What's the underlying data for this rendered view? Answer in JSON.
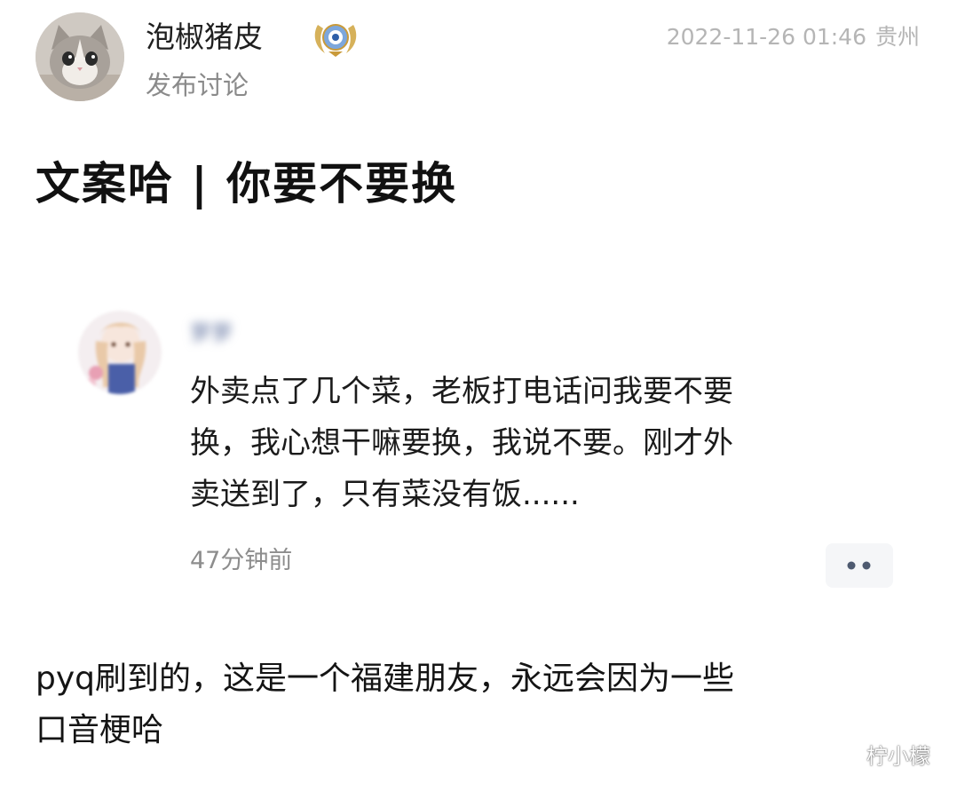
{
  "post": {
    "author_name": "泡椒猪皮",
    "post_type": "发布讨论",
    "datetime": "2022-11-26 01:46",
    "location": "贵州",
    "title": "文案哈 | 你要不要换"
  },
  "embedded_post": {
    "author_name": "萝萝",
    "text_lines": [
      "外卖点了几个菜，老板打电话问我要不要",
      "换，我心想干嘛要换，我说不要。刚才外",
      "卖送到了，只有菜没有饭......"
    ],
    "time": "47分钟前"
  },
  "body": {
    "lines": [
      "pyq刷到的，这是一个福建朋友，永远会因为一些",
      "口音梗哈"
    ]
  },
  "watermark": {
    "text": "柠小檬"
  }
}
